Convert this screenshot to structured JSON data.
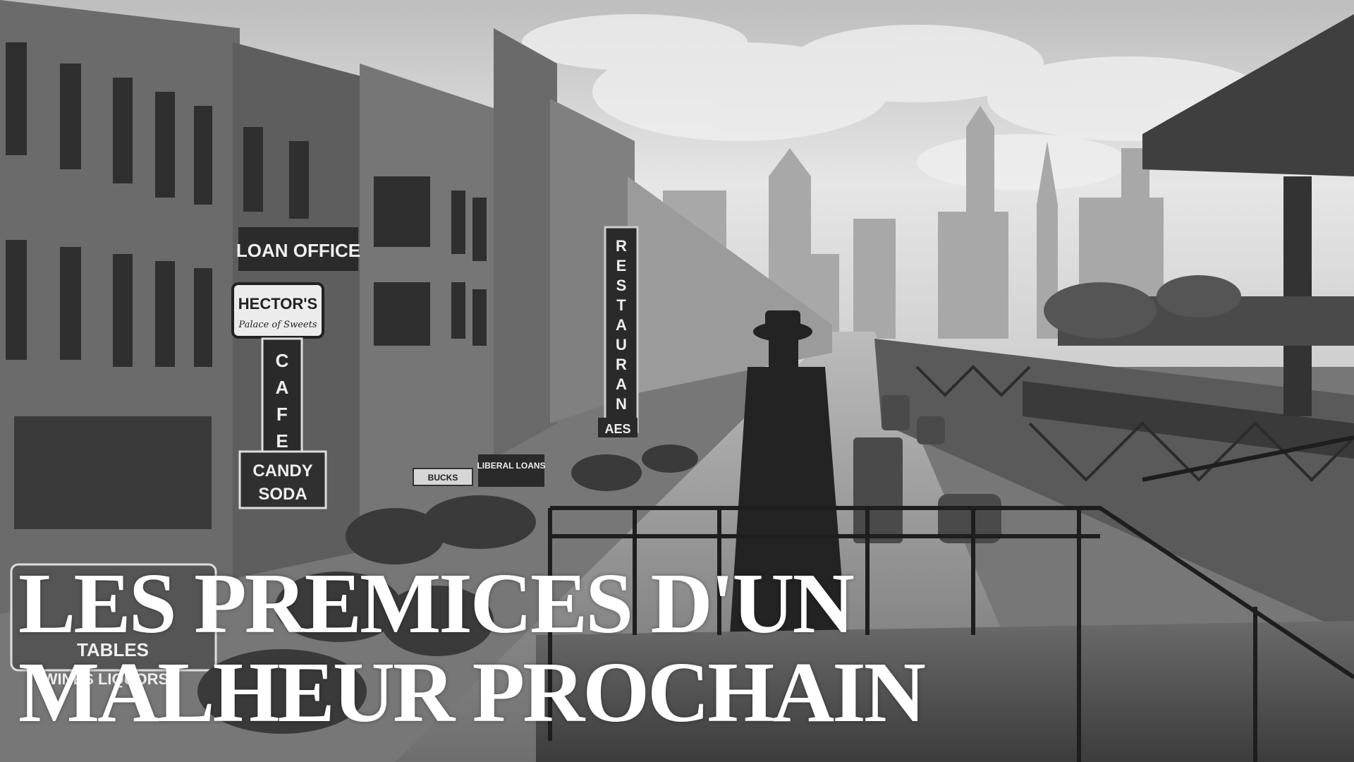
{
  "title": {
    "line1": "LES PREMICES D'UN",
    "line2": "MALHEUR PROCHAIN"
  },
  "signs": {
    "loan_office": "LOAN OFFICE",
    "hectors": "HECTOR'S",
    "palace_of_sweets": "Palace of Sweets",
    "cafe": "CAFE",
    "candy": "CANDY",
    "soda": "SODA",
    "restaurant": "RESTAURANT",
    "liberal_loans": "LIBERAL LOANS",
    "bucks": "BUCKS",
    "tables": "TABLES",
    "wines_liquors": "WINES LIQUORS",
    "aes": "AES"
  },
  "palette": {
    "sky": "#d9d9d9",
    "building_dark": "#4a4a4a",
    "building_mid": "#7a7a7a",
    "street": "#8c8c8c",
    "title": "#ffffff"
  }
}
